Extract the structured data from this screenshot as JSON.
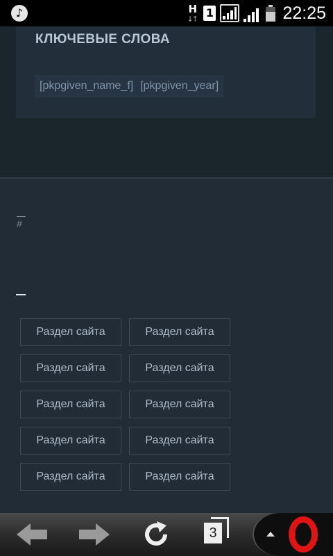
{
  "status_bar": {
    "clock": "22:25",
    "sim_slot": "1",
    "network_type": "H",
    "icons": [
      "music-icon",
      "network-h-icon",
      "sim-icon",
      "signal-icon",
      "signal-icon",
      "battery-icon"
    ]
  },
  "keywords": {
    "title": "КЛЮЧЕВЫЕ СЛОВА",
    "tags": [
      "[pkpgiven_name_f]",
      "[pkpgiven_year]"
    ]
  },
  "links": {
    "hash": "#"
  },
  "site_sections": {
    "items": [
      {
        "label": "Раздел сайта"
      },
      {
        "label": "Раздел сайта"
      },
      {
        "label": "Раздел сайта"
      },
      {
        "label": "Раздел сайта"
      },
      {
        "label": "Раздел сайта"
      },
      {
        "label": "Раздел сайта"
      },
      {
        "label": "Раздел сайта"
      },
      {
        "label": "Раздел сайта"
      },
      {
        "label": "Раздел сайта"
      },
      {
        "label": "Раздел сайта"
      }
    ]
  },
  "browser_bar": {
    "tabs_count": "3",
    "icons": [
      "back-arrow-icon",
      "forward-arrow-icon",
      "reload-icon",
      "tabs-icon",
      "menu-up-icon",
      "opera-logo-icon"
    ],
    "colors": {
      "opera_red": "#e01414",
      "bar_dark": "#1a1a1a"
    }
  }
}
